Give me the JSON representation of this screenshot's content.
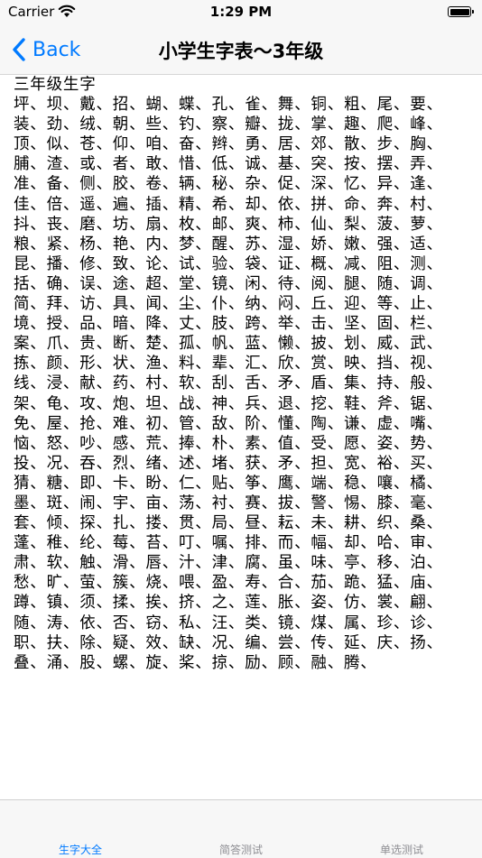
{
  "status_bar": {
    "carrier": "Carrier",
    "time": "1:29 PM"
  },
  "nav": {
    "back_label": "Back",
    "title": "小学生字表～3年级"
  },
  "content": {
    "heading": "三年级生字",
    "lines": [
      "坪、坝、戴、招、蝴、蝶、孔、雀、舞、铜、粗、尾、要、",
      "装、劲、绒、朝、些、钓、察、瓣、拢、掌、趣、爬、峰、",
      "顶、似、苍、仰、咱、奋、辫、勇、居、郊、散、步、胸、",
      "脯、渣、或、者、敢、惜、低、诚、基、突、按、摆、弄、",
      "准、备、侧、胶、卷、辆、秘、杂、促、深、忆、异、逢、",
      "佳、倍、遥、遍、插、精、希、却、依、拼、命、奔、村、",
      "抖、丧、磨、坊、扇、枚、邮、爽、柿、仙、梨、菠、萝、",
      "粮、紧、杨、艳、内、梦、醒、苏、湿、娇、嫩、强、适、",
      "昆、播、修、致、论、试、验、袋、证、概、减、阻、测、",
      "括、确、误、途、超、堂、镜、闲、待、阅、腿、随、调、",
      "简、拜、访、具、闻、尘、仆、纳、闷、丘、迎、等、止、",
      "境、授、品、暗、降、丈、肢、跨、举、击、坚、固、栏、",
      "案、爪、贵、断、楚、孤、帆、蓝、懒、披、划、威、武、",
      "拣、颜、形、状、渔、料、辈、汇、欣、赏、映、挡、视、",
      "线、浸、献、药、村、软、刮、舌、矛、盾、集、持、般、",
      "架、龟、攻、炮、坦、战、神、兵、退、挖、鞋、斧、锯、",
      "免、屋、抢、难、初、管、敌、阶、懂、陶、谦、虚、嘴、",
      "恼、怒、吵、感、荒、捧、朴、素、值、受、愿、姿、势、",
      "投、况、吞、烈、绪、述、堵、获、矛、担、宽、裕、买、",
      "猜、糖、即、卡、盼、仁、贴、筝、鹰、端、稳、嚷、橘、",
      "墨、斑、闹、宇、亩、荡、衬、赛、拔、警、惕、膝、毫、",
      "套、倾、探、扎、搂、贯、局、昼、耘、未、耕、织、桑、",
      "蓬、稚、纶、莓、苔、叮、嘱、排、而、幅、却、哈、审、",
      "肃、软、触、滑、唇、汁、津、腐、虽、味、亭、移、泊、",
      "愁、旷、萤、簇、烧、喂、盈、寿、合、茄、跪、猛、庙、",
      "蹲、镇、须、揉、挨、挤、之、莲、胀、姿、仿、裳、翩、",
      "随、涛、依、否、窃、私、汪、类、镜、煤、属、珍、诊、",
      "职、扶、除、疑、效、缺、况、编、尝、传、延、庆、扬、",
      "叠、涌、股、螺、旋、桨、掠、励、顾、融、腾、"
    ]
  },
  "tabs": [
    {
      "label": "生字大全",
      "active": true
    },
    {
      "label": "简答测试",
      "active": false
    },
    {
      "label": "单选测试",
      "active": false
    }
  ],
  "colors": {
    "accent": "#007aff",
    "inactive_tab": "#8e8e93",
    "bar_bg": "#f7f7f7"
  }
}
